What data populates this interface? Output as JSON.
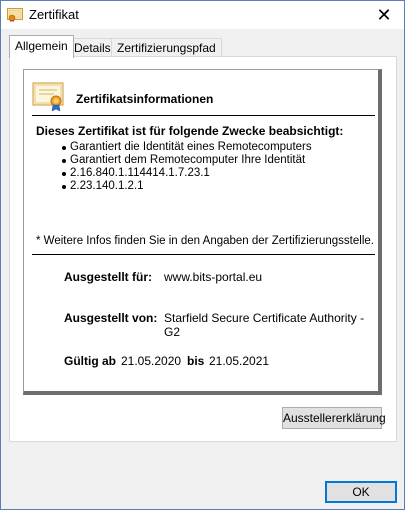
{
  "window": {
    "title": "Zertifikat",
    "close_symbol": "✕"
  },
  "tabs": [
    {
      "label": "Allgemein",
      "active": true
    },
    {
      "label": "Details",
      "active": false
    },
    {
      "label": "Zertifizierungspfad",
      "active": false
    }
  ],
  "info": {
    "heading": "Zertifikatsinformationen",
    "purpose_heading": "Dieses Zertifikat ist für folgende Zwecke beabsichtigt:",
    "purposes": [
      "Garantiert die Identität eines Remotecomputers",
      "Garantiert dem Remotecomputer Ihre Identität",
      "2.16.840.1.114414.1.7.23.1",
      "2.23.140.1.2.1"
    ],
    "footnote": "* Weitere Infos finden Sie in den Angaben der Zertifizierungsstelle.",
    "issued_to_label": "Ausgestellt für:",
    "issued_to_value": "www.bits-portal.eu",
    "issued_by_label": "Ausgestellt von:",
    "issued_by_value": "Starfield Secure Certificate Authority - G2",
    "valid_from_label": "Gültig ab",
    "valid_from_value": "21.05.2020",
    "valid_to_label": "bis",
    "valid_to_value": "21.05.2021"
  },
  "buttons": {
    "issuer_statement": "Ausstellererklärung",
    "ok": "OK"
  },
  "colors": {
    "window_border": "#5a7fb8",
    "ok_border": "#0078d7",
    "dialog_bg": "#f0f0f0"
  }
}
